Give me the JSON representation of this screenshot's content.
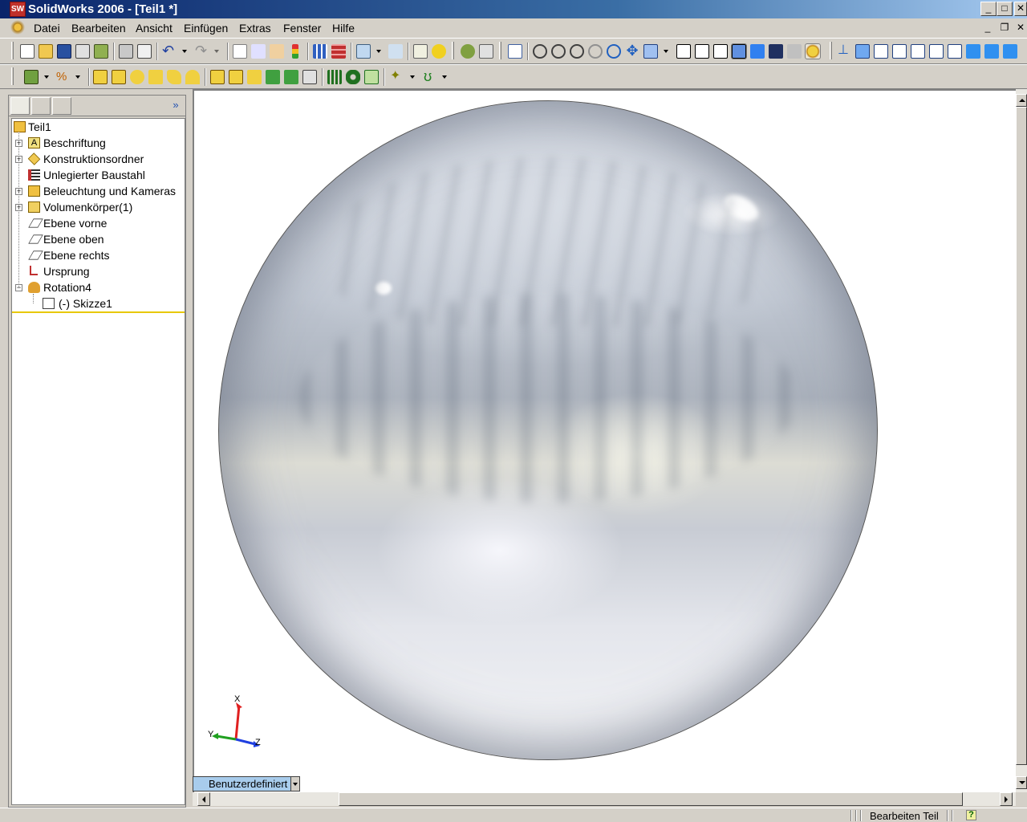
{
  "window": {
    "title": "SolidWorks 2006 - [Teil1 *]",
    "app_icon_text": "SW"
  },
  "window_buttons": {
    "minimize": "_",
    "maximize": "□",
    "close": "✕",
    "restore": "❐"
  },
  "menu": [
    "Datei",
    "Bearbeiten",
    "Ansicht",
    "Einfügen",
    "Extras",
    "Fenster",
    "Hilfe"
  ],
  "feature_tree": {
    "items": [
      {
        "label": "Teil1",
        "icon": "part-icon"
      },
      {
        "label": "Beschriftung",
        "icon": "annotations-icon"
      },
      {
        "label": "Konstruktionsordner",
        "icon": "design-binder-icon"
      },
      {
        "label": "Unlegierter Baustahl",
        "icon": "material-icon"
      },
      {
        "label": "Beleuchtung und Kameras",
        "icon": "lights-cameras-icon"
      },
      {
        "label": "Volumenkörper(1)",
        "icon": "solid-bodies-icon"
      },
      {
        "label": "Ebene vorne",
        "icon": "plane-icon"
      },
      {
        "label": "Ebene oben",
        "icon": "plane-icon"
      },
      {
        "label": "Ebene rechts",
        "icon": "plane-icon"
      },
      {
        "label": "Ursprung",
        "icon": "origin-icon"
      },
      {
        "label": "Rotation4",
        "icon": "revolve-icon"
      },
      {
        "label": "(-) Skizze1",
        "icon": "sketch-icon"
      }
    ]
  },
  "triad": {
    "x": "X",
    "y": "Y",
    "z": "Z"
  },
  "configuration_tab": "Benutzerdefiniert",
  "status": {
    "mode": "Bearbeiten Teil",
    "help": "?"
  },
  "colors": {
    "titlebar": "#0a246a",
    "accent": "#3a6ea5",
    "tree_rollback_bar": "#e8c800",
    "config_tab": "#a8ccec"
  }
}
